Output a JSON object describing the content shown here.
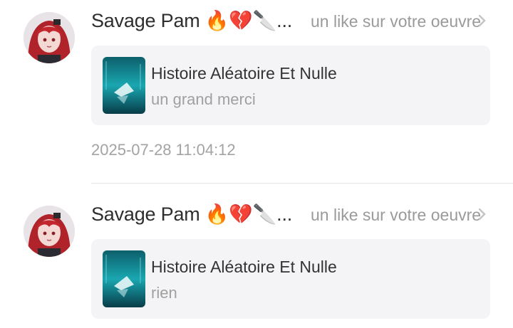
{
  "notifications": [
    {
      "user_name": "Savage Pam 🔥💔🔪...",
      "action_text": "un like sur votre oeuvre",
      "work_title": "Histoire Aléatoire Et Nulle",
      "comment": "un grand merci",
      "timestamp": "2025-07-28 11:04:12"
    },
    {
      "user_name": "Savage Pam 🔥💔🔪...",
      "action_text": "un like sur votre oeuvre",
      "work_title": "Histoire Aléatoire Et Nulle",
      "comment": "rien"
    }
  ],
  "colors": {
    "background": "#ffffff",
    "card": "#f4f4f6",
    "primary_text": "#2e2e2e",
    "secondary_text": "#9a9a9a",
    "divider": "#e4e4e4"
  },
  "icons": [
    "avatar-image",
    "chevron-right-icon",
    "artwork-thumbnail"
  ]
}
